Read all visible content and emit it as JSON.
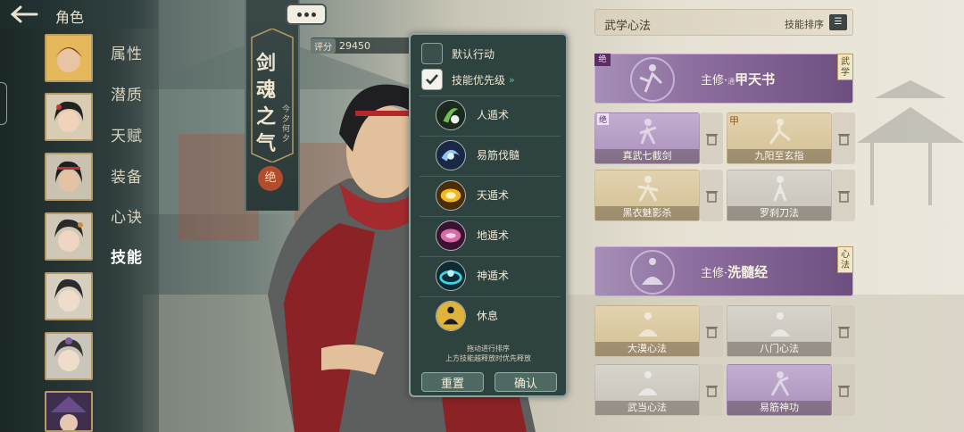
{
  "topbar": {
    "title": "角色"
  },
  "sidebar": {
    "items": [
      {
        "label": "属性",
        "active": false
      },
      {
        "label": "潜质",
        "active": false
      },
      {
        "label": "天赋",
        "active": false
      },
      {
        "label": "装备",
        "active": false
      },
      {
        "label": "心诀",
        "active": false
      },
      {
        "label": "技能",
        "active": true
      }
    ]
  },
  "character": {
    "banner_name": "剑魂之气",
    "banner_sub": "今夕何夕",
    "tier": "绝",
    "score_label": "评分",
    "score_value": "29450"
  },
  "popup": {
    "default_action_label": "默认行动",
    "default_action_checked": false,
    "priority_label": "技能优先级",
    "priority_checked": true,
    "skills": [
      {
        "name": "人遁术",
        "icon": "human-escape-icon",
        "color": "#3c6b3a"
      },
      {
        "name": "易筋伐髓",
        "icon": "tendon-change-icon",
        "color": "#2c4a7a"
      },
      {
        "name": "天遁术",
        "icon": "heaven-escape-icon",
        "color": "#c48a16"
      },
      {
        "name": "地遁术",
        "icon": "earth-escape-icon",
        "color": "#9a3f6e"
      },
      {
        "name": "神遁术",
        "icon": "divine-escape-icon",
        "color": "#1d6b7a"
      },
      {
        "name": "休息",
        "icon": "meditation-icon",
        "color": "#c99b2c"
      }
    ],
    "note_line1": "拖动进行排序",
    "note_line2": "上方技能越释放时优先释放",
    "reset_label": "重置",
    "confirm_label": "确认"
  },
  "martial": {
    "title": "武学心法",
    "sort_label": "技能排序",
    "master1": {
      "prefix": "主修·",
      "small": "通",
      "name": "甲天书",
      "tag_left": "绝",
      "tag_right": "武学"
    },
    "master2": {
      "prefix": "主修·",
      "name": "洗髓经",
      "tag_right": "心法"
    },
    "skills_top": [
      {
        "name": "真武七截剑",
        "style": "purple",
        "corner": "绝"
      },
      {
        "name": "九阳至玄指",
        "style": "gold",
        "corner": "甲"
      },
      {
        "name": "黑衣魅影杀",
        "style": "gold",
        "corner": ""
      },
      {
        "name": "罗刹刀法",
        "style": "gray",
        "corner": ""
      }
    ],
    "skills_bottom": [
      {
        "name": "大漠心法",
        "style": "gold",
        "corner": ""
      },
      {
        "name": "八门心法",
        "style": "gray",
        "corner": ""
      },
      {
        "name": "武当心法",
        "style": "gray",
        "corner": ""
      },
      {
        "name": "易筋神功",
        "style": "purple",
        "corner": ""
      }
    ]
  },
  "colors": {
    "panel": "#2e4240",
    "accent_teal": "#5db9a6",
    "purple": "#8c6d9e"
  }
}
